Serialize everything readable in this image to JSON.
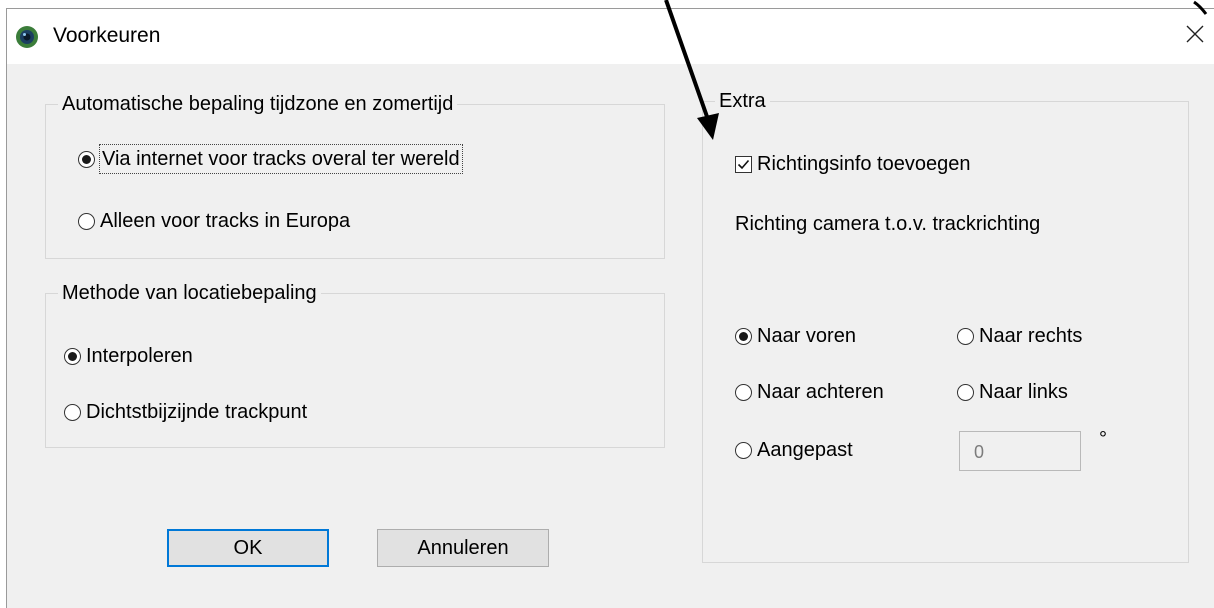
{
  "window": {
    "title": "Voorkeuren"
  },
  "timezone_group": {
    "title": "Automatische bepaling tijdzone en zomertijd",
    "options": [
      {
        "label": "Via internet voor tracks overal ter wereld",
        "selected": true
      },
      {
        "label": "Alleen voor tracks in Europa",
        "selected": false
      }
    ]
  },
  "location_group": {
    "title": "Methode van locatiebepaling",
    "options": [
      {
        "label": "Interpoleren",
        "selected": true
      },
      {
        "label": "Dichtstbijzijnde trackpunt",
        "selected": false
      }
    ]
  },
  "extra_group": {
    "title": "Extra",
    "checkbox_label": "Richtingsinfo toevoegen",
    "checkbox_checked": true,
    "direction_label": "Richting camera t.o.v. trackrichting",
    "options": [
      {
        "label": "Naar voren",
        "selected": true
      },
      {
        "label": "Naar rechts",
        "selected": false
      },
      {
        "label": "Naar achteren",
        "selected": false
      },
      {
        "label": "Naar links",
        "selected": false
      },
      {
        "label": "Aangepast",
        "selected": false
      }
    ],
    "custom_value": "0",
    "degree_symbol": "°"
  },
  "buttons": {
    "ok": "OK",
    "cancel": "Annuleren"
  },
  "icons": {
    "app": "app-icon",
    "close": "close-icon"
  }
}
